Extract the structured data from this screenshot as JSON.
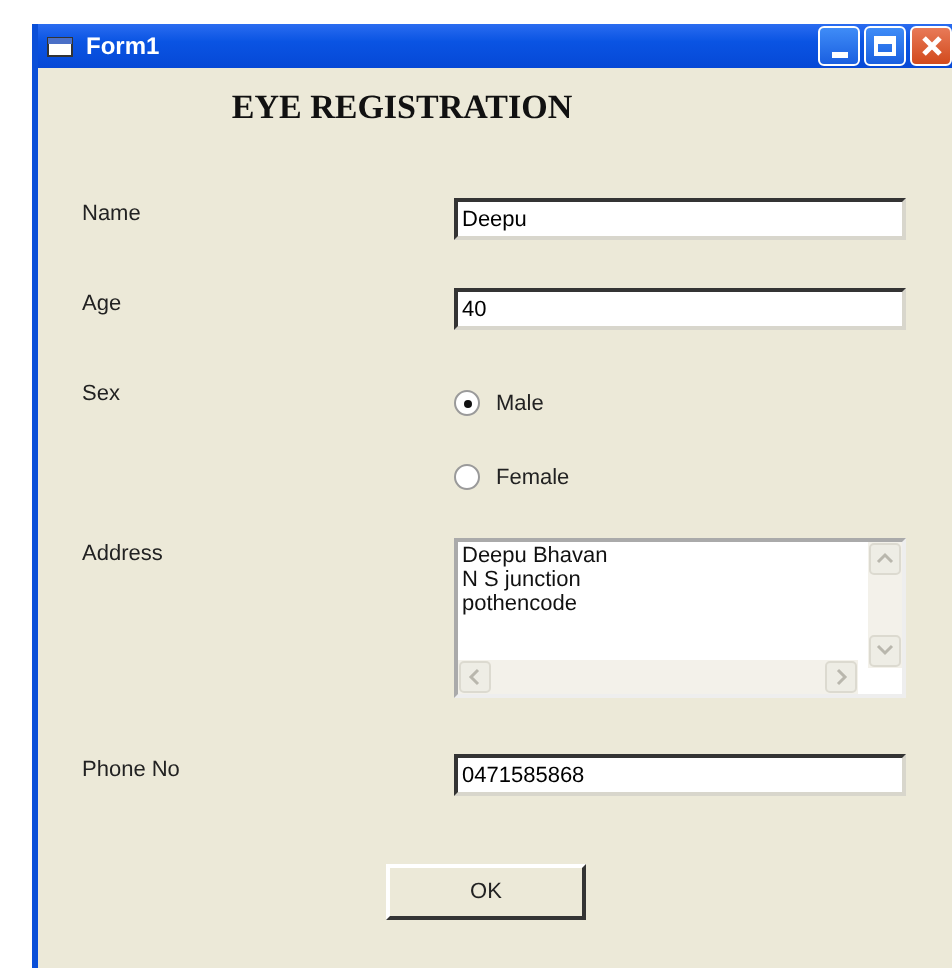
{
  "window": {
    "title": "Form1"
  },
  "heading": "EYE REGISTRATION",
  "fields": [
    {
      "kind": "text",
      "label": "Name",
      "value": "Deepu"
    },
    {
      "kind": "text",
      "label": "Age",
      "value": "40"
    },
    {
      "kind": "radio",
      "label": "Sex",
      "options": [
        {
          "label": "Male",
          "selected": true
        },
        {
          "label": "Female",
          "selected": false
        }
      ]
    },
    {
      "kind": "textarea",
      "label": "Address",
      "value": "Deepu Bhavan\nN S junction\npothencode"
    },
    {
      "kind": "text",
      "label": "Phone No",
      "value": "0471585868"
    }
  ],
  "buttons": [
    "OK"
  ]
}
